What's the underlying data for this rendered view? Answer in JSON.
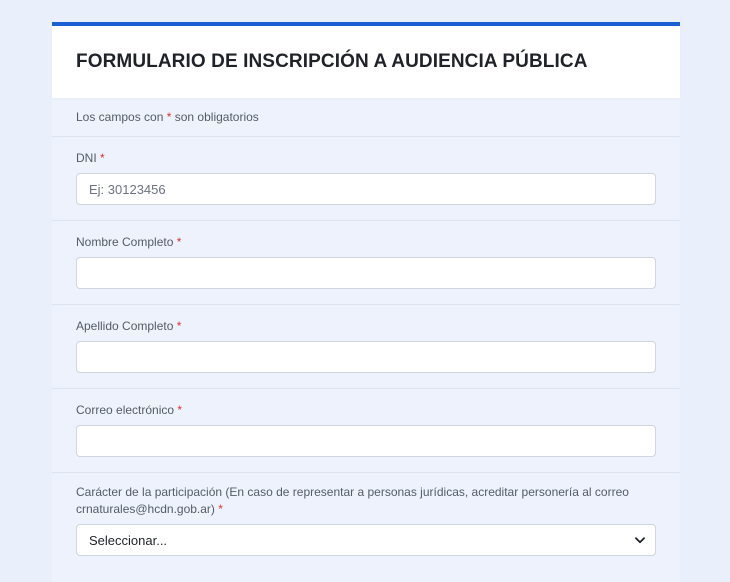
{
  "form": {
    "title": "FORMULARIO DE INSCRIPCIÓN A AUDIENCIA PÚBLICA",
    "required_note": {
      "prefix": "Los campos con ",
      "marker": "*",
      "suffix": " son obligatorios"
    },
    "fields": {
      "dni": {
        "label": "DNI",
        "required_marker": "*",
        "placeholder": "Ej: 30123456",
        "value": ""
      },
      "nombre": {
        "label": "Nombre Completo",
        "required_marker": "*",
        "value": ""
      },
      "apellido": {
        "label": "Apellido Completo",
        "required_marker": "*",
        "value": ""
      },
      "correo": {
        "label": "Correo electrónico",
        "required_marker": "*",
        "value": ""
      },
      "caracter": {
        "label": "Carácter de la participación (En caso de representar a personas jurídicas, acreditar personería al correo crnaturales@hcdn.gob.ar)",
        "required_marker": "*",
        "selected": "Seleccionar..."
      }
    }
  },
  "icons": {
    "dropdown": "chevron-down-icon"
  },
  "colors": {
    "accent": "#1a5fd4",
    "required": "#d9342b",
    "background": "#eaf0fb"
  }
}
